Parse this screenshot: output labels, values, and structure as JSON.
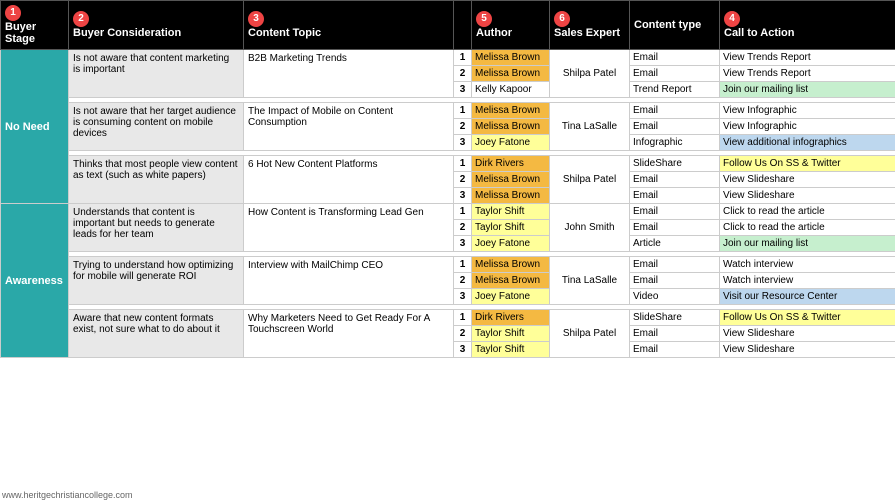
{
  "columns": {
    "c1_label": "Buyer Stage",
    "c2_label": "Buyer Consideration",
    "c3_label": "Content Topic",
    "c5_label": "Author",
    "c6_label": "Sales Expert",
    "c7_label": "Content type",
    "c8_label": "Call to Action",
    "nums": [
      "1",
      "2",
      "3",
      "4",
      "5",
      "6"
    ]
  },
  "sections": [
    {
      "stage": "No Need",
      "stage_rowspan": 9,
      "groups": [
        {
          "consideration": "Is not aware that content marketing is important",
          "consideration_rowspan": 3,
          "topic": "B2B Marketing Trends",
          "topic_rowspan": 3,
          "rows": [
            {
              "num": "1",
              "author": "Melissa Brown",
              "author_class": "author-brown",
              "sales_expert": "",
              "sales_rowspan": 0,
              "content_type": "Email",
              "cta": "View Trends Report",
              "cta_class": "cta-white"
            },
            {
              "num": "2",
              "author": "Melissa Brown",
              "author_class": "author-brown",
              "sales_expert": "Shilpa Patel",
              "sales_rowspan": 3,
              "content_type": "Email",
              "cta": "View Trends Report",
              "cta_class": "cta-white"
            },
            {
              "num": "3",
              "author": "Kelly Kapoor",
              "author_class": "author-kelly",
              "sales_expert": "",
              "sales_rowspan": 0,
              "content_type": "Trend Report",
              "cta": "Join our mailing list",
              "cta_class": "cta-green"
            }
          ]
        },
        {
          "consideration": "Is not aware that her target audience is consuming content on mobile devices",
          "consideration_rowspan": 3,
          "topic": "The Impact of Mobile on Content Consumption",
          "topic_rowspan": 3,
          "rows": [
            {
              "num": "1",
              "author": "Melissa Brown",
              "author_class": "author-brown",
              "sales_expert": "",
              "sales_rowspan": 0,
              "content_type": "Email",
              "cta": "View Infographic",
              "cta_class": "cta-white"
            },
            {
              "num": "2",
              "author": "Melissa Brown",
              "author_class": "author-brown",
              "sales_expert": "Tina LaSalle",
              "sales_rowspan": 3,
              "content_type": "Email",
              "cta": "View Infographic",
              "cta_class": "cta-white"
            },
            {
              "num": "3",
              "author": "Joey Fatone",
              "author_class": "author-joey",
              "sales_expert": "",
              "sales_rowspan": 0,
              "content_type": "Infographic",
              "cta": "View additional infographics",
              "cta_class": "cta-blue"
            }
          ]
        },
        {
          "consideration": "Thinks that most people view content as text (such as white papers)",
          "consideration_rowspan": 3,
          "topic": "6 Hot New Content Platforms",
          "topic_rowspan": 3,
          "rows": [
            {
              "num": "1",
              "author": "Dirk Rivers",
              "author_class": "author-dirk",
              "sales_expert": "",
              "sales_rowspan": 0,
              "content_type": "SlideShare",
              "cta": "Follow Us On SS & Twitter",
              "cta_class": "cta-yellow"
            },
            {
              "num": "2",
              "author": "Melissa Brown",
              "author_class": "author-brown",
              "sales_expert": "Shilpa Patel",
              "sales_rowspan": 3,
              "content_type": "Email",
              "cta": "View Slideshare",
              "cta_class": "cta-white"
            },
            {
              "num": "3",
              "author": "Melissa Brown",
              "author_class": "author-brown",
              "sales_expert": "",
              "sales_rowspan": 0,
              "content_type": "Email",
              "cta": "View Slideshare",
              "cta_class": "cta-white"
            }
          ]
        }
      ]
    },
    {
      "stage": "Awareness",
      "stage_rowspan": 9,
      "groups": [
        {
          "consideration": "Understands that content is important but needs to generate leads for her team",
          "consideration_rowspan": 3,
          "topic": "How Content is Transforming Lead Gen",
          "topic_rowspan": 3,
          "rows": [
            {
              "num": "1",
              "author": "Taylor Shift",
              "author_class": "author-taylor",
              "sales_expert": "",
              "sales_rowspan": 0,
              "content_type": "Email",
              "cta": "Click to read the article",
              "cta_class": "cta-white"
            },
            {
              "num": "2",
              "author": "Taylor Shift",
              "author_class": "author-taylor",
              "sales_expert": "John Smith",
              "sales_rowspan": 3,
              "content_type": "Email",
              "cta": "Click to read the article",
              "cta_class": "cta-white"
            },
            {
              "num": "3",
              "author": "Joey Fatone",
              "author_class": "author-joey",
              "sales_expert": "",
              "sales_rowspan": 0,
              "content_type": "Article",
              "cta": "Join our mailing list",
              "cta_class": "cta-green"
            }
          ]
        },
        {
          "consideration": "Trying to understand how optimizing for mobile will generate ROI",
          "consideration_rowspan": 3,
          "topic": "Interview with MailChimp CEO",
          "topic_rowspan": 3,
          "rows": [
            {
              "num": "1",
              "author": "Melissa Brown",
              "author_class": "author-brown",
              "sales_expert": "",
              "sales_rowspan": 0,
              "content_type": "Email",
              "cta": "Watch interview",
              "cta_class": "cta-white"
            },
            {
              "num": "2",
              "author": "Melissa Brown",
              "author_class": "author-brown",
              "sales_expert": "Tina LaSalle",
              "sales_rowspan": 3,
              "content_type": "Email",
              "cta": "Watch interview",
              "cta_class": "cta-white"
            },
            {
              "num": "3",
              "author": "Joey Fatone",
              "author_class": "author-joey",
              "sales_expert": "",
              "sales_rowspan": 0,
              "content_type": "Video",
              "cta": "Visit our Resource Center",
              "cta_class": "cta-blue"
            }
          ]
        },
        {
          "consideration": "Aware that new content formats exist, not sure what to do about it",
          "consideration_rowspan": 3,
          "topic": "Why Marketers Need to Get Ready For A Touchscreen World",
          "topic_rowspan": 3,
          "rows": [
            {
              "num": "1",
              "author": "Dirk Rivers",
              "author_class": "author-dirk",
              "sales_expert": "",
              "sales_rowspan": 0,
              "content_type": "SlideShare",
              "cta": "Follow Us On SS & Twitter",
              "cta_class": "cta-yellow"
            },
            {
              "num": "2",
              "author": "Taylor Shift",
              "author_class": "author-taylor",
              "sales_expert": "Shilpa Patel",
              "sales_rowspan": 3,
              "content_type": "Email",
              "cta": "View Slideshare",
              "cta_class": "cta-white"
            },
            {
              "num": "3",
              "author": "Taylor Shift",
              "author_class": "author-taylor",
              "sales_expert": "",
              "sales_rowspan": 0,
              "content_type": "Email",
              "cta": "View Slideshare",
              "cta_class": "cta-white"
            }
          ]
        }
      ]
    }
  ],
  "watermark": "www.heritgechristiancollege.com"
}
